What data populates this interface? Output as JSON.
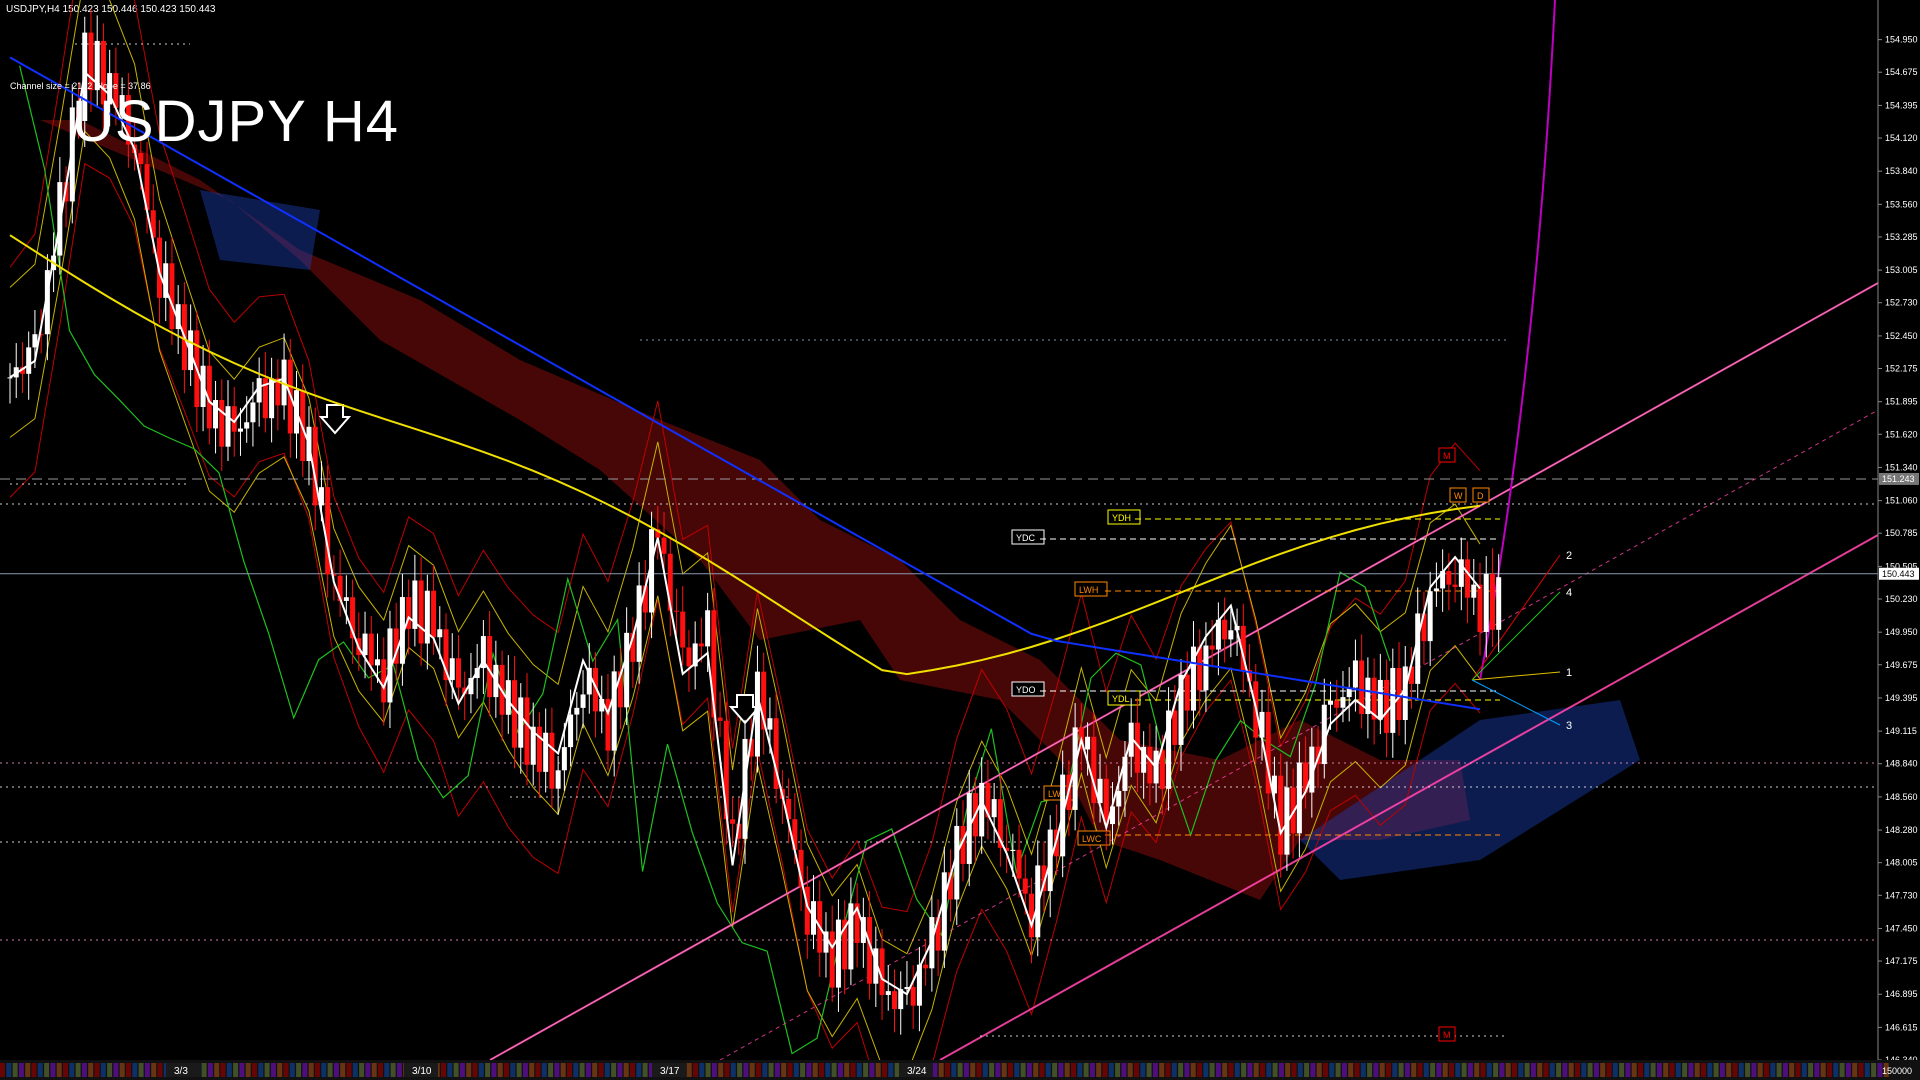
{
  "header": {
    "symbol_line": "USDJPY,H4  150.423 150.446 150.423 150.443"
  },
  "overlay": {
    "channel_info": "Channel size = 2122 Slope = 37.86",
    "big_title": "USDJPY H4"
  },
  "chart_data": {
    "type": "candlestick",
    "symbol": "USDJPY",
    "timeframe": "H4",
    "ohlc_last": {
      "open": 150.423,
      "high": 150.446,
      "low": 150.423,
      "close": 150.443
    },
    "ylim": [
      146.34,
      155.2
    ],
    "y_ticks": [
      "154.950",
      "154.675",
      "154.395",
      "154.120",
      "153.840",
      "153.560",
      "153.285",
      "153.005",
      "152.730",
      "152.450",
      "152.175",
      "151.895",
      "151.620",
      "151.340",
      "151.060",
      "150.785",
      "150.505",
      "150.230",
      "149.950",
      "149.675",
      "149.395",
      "149.115",
      "148.840",
      "148.560",
      "148.280",
      "148.005",
      "147.730",
      "147.450",
      "147.175",
      "146.895",
      "146.615",
      "146.340"
    ],
    "x_labels": [
      "3/3",
      "3/10",
      "3/17",
      "3/24"
    ],
    "current_price_label": "150.443",
    "line_price_label": "151.243",
    "price_path": [
      152.1,
      152.3,
      153.5,
      154.8,
      154.6,
      154.1,
      153.0,
      152.4,
      151.8,
      151.6,
      151.9,
      152.0,
      151.5,
      150.4,
      149.9,
      149.6,
      150.2,
      150.0,
      149.4,
      149.7,
      149.3,
      149.0,
      148.8,
      149.6,
      149.2,
      149.9,
      150.8,
      149.7,
      149.9,
      148.1,
      149.5,
      148.6,
      147.6,
      147.2,
      147.5,
      146.9,
      146.8,
      147.3,
      148.1,
      148.6,
      148.2,
      147.6,
      148.3,
      149.1,
      148.3,
      149.0,
      148.7,
      149.4,
      149.8,
      150.1,
      149.3,
      148.3,
      148.7,
      149.3,
      149.5,
      149.3,
      149.5,
      150.3,
      150.5,
      150.2
    ],
    "level_tags": [
      "YDC",
      "YDH",
      "LWH",
      "YDO",
      "YDL",
      "LWL",
      "LWC",
      "W",
      "D",
      "M",
      "M"
    ],
    "projection_labels": [
      "1",
      "2",
      "3",
      "4"
    ],
    "bottom_value": "150000"
  }
}
